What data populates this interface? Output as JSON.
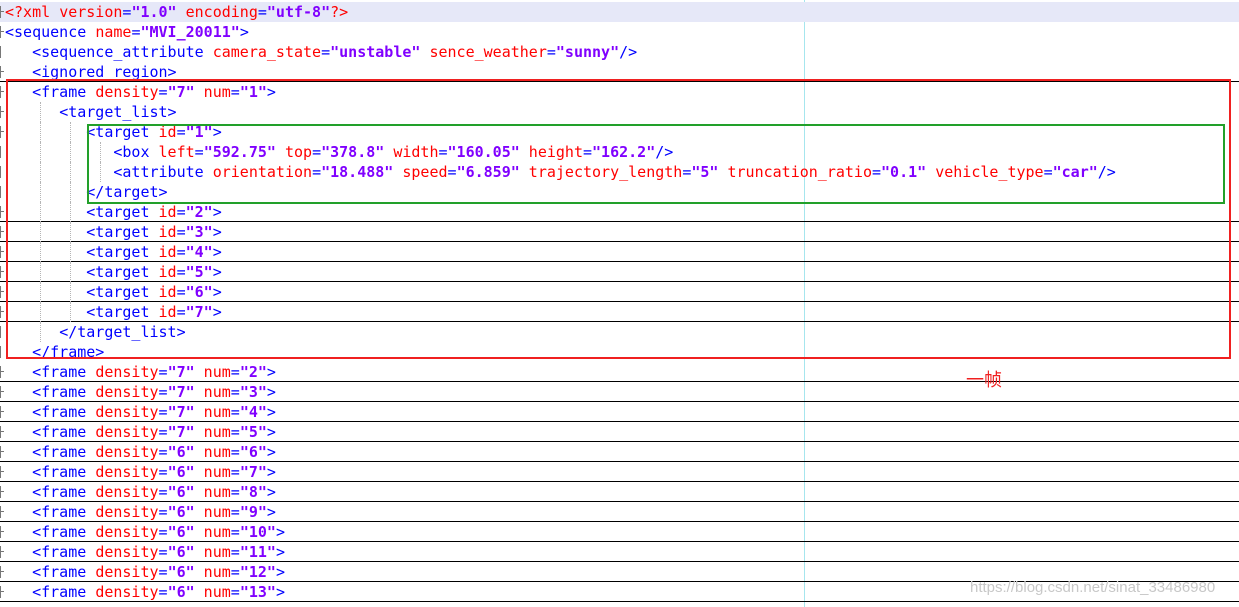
{
  "lines": [
    {
      "hl": true,
      "underline": false,
      "fold": "plus",
      "indent": 0,
      "tokens": [
        {
          "t": "<?xml ",
          "c": "pi"
        },
        {
          "t": "version",
          "c": "attr"
        },
        {
          "t": "=",
          "c": "eq"
        },
        {
          "t": "\"1.0\"",
          "c": "val"
        },
        {
          "t": " encoding",
          "c": "attr"
        },
        {
          "t": "=",
          "c": "eq"
        },
        {
          "t": "\"utf-8\"",
          "c": "val"
        },
        {
          "t": "?>",
          "c": "pi"
        }
      ]
    },
    {
      "hl": false,
      "underline": false,
      "fold": "plus",
      "indent": 0,
      "tokens": [
        {
          "t": "<sequence ",
          "c": "tag"
        },
        {
          "t": "name",
          "c": "attr"
        },
        {
          "t": "=",
          "c": "eq"
        },
        {
          "t": "\"MVI_20011\"",
          "c": "val"
        },
        {
          "t": ">",
          "c": "tag"
        }
      ]
    },
    {
      "hl": false,
      "underline": false,
      "fold": "line",
      "indent": 1,
      "tokens": [
        {
          "t": "<sequence_attribute ",
          "c": "tag"
        },
        {
          "t": "camera_state",
          "c": "attr"
        },
        {
          "t": "=",
          "c": "eq"
        },
        {
          "t": "\"unstable\"",
          "c": "val"
        },
        {
          "t": " sence_weather",
          "c": "attr"
        },
        {
          "t": "=",
          "c": "eq"
        },
        {
          "t": "\"sunny\"",
          "c": "val"
        },
        {
          "t": "/>",
          "c": "tag"
        }
      ]
    },
    {
      "hl": false,
      "underline": true,
      "fold": "plus",
      "indent": 1,
      "tokens": [
        {
          "t": "<ignored_region>",
          "c": "tag"
        }
      ]
    },
    {
      "hl": false,
      "underline": false,
      "fold": "plus",
      "indent": 1,
      "tokens": [
        {
          "t": "<frame ",
          "c": "tag"
        },
        {
          "t": "density",
          "c": "attr"
        },
        {
          "t": "=",
          "c": "eq"
        },
        {
          "t": "\"7\"",
          "c": "val"
        },
        {
          "t": " num",
          "c": "attr"
        },
        {
          "t": "=",
          "c": "eq"
        },
        {
          "t": "\"1\"",
          "c": "val"
        },
        {
          "t": ">",
          "c": "tag"
        }
      ]
    },
    {
      "hl": false,
      "underline": false,
      "fold": "plus",
      "indent": 2,
      "tokens": [
        {
          "t": "<target_list>",
          "c": "tag"
        }
      ]
    },
    {
      "hl": false,
      "underline": false,
      "fold": "plus",
      "indent": 3,
      "tokens": [
        {
          "t": "<target ",
          "c": "tag"
        },
        {
          "t": "id",
          "c": "attr"
        },
        {
          "t": "=",
          "c": "eq"
        },
        {
          "t": "\"1\"",
          "c": "val"
        },
        {
          "t": ">",
          "c": "tag"
        }
      ]
    },
    {
      "hl": false,
      "underline": false,
      "fold": "line",
      "indent": 4,
      "tokens": [
        {
          "t": "<box ",
          "c": "tag"
        },
        {
          "t": "left",
          "c": "attr"
        },
        {
          "t": "=",
          "c": "eq"
        },
        {
          "t": "\"592.75\"",
          "c": "val"
        },
        {
          "t": " top",
          "c": "attr"
        },
        {
          "t": "=",
          "c": "eq"
        },
        {
          "t": "\"378.8\"",
          "c": "val"
        },
        {
          "t": " width",
          "c": "attr"
        },
        {
          "t": "=",
          "c": "eq"
        },
        {
          "t": "\"160.05\"",
          "c": "val"
        },
        {
          "t": " height",
          "c": "attr"
        },
        {
          "t": "=",
          "c": "eq"
        },
        {
          "t": "\"162.2\"",
          "c": "val"
        },
        {
          "t": "/>",
          "c": "tag"
        }
      ]
    },
    {
      "hl": false,
      "underline": false,
      "fold": "line",
      "indent": 4,
      "tokens": [
        {
          "t": "<attribute ",
          "c": "tag"
        },
        {
          "t": "orientation",
          "c": "attr"
        },
        {
          "t": "=",
          "c": "eq"
        },
        {
          "t": "\"18.488\"",
          "c": "val"
        },
        {
          "t": " speed",
          "c": "attr"
        },
        {
          "t": "=",
          "c": "eq"
        },
        {
          "t": "\"6.859\"",
          "c": "val"
        },
        {
          "t": " trajectory_length",
          "c": "attr"
        },
        {
          "t": "=",
          "c": "eq"
        },
        {
          "t": "\"5\"",
          "c": "val"
        },
        {
          "t": " truncation_ratio",
          "c": "attr"
        },
        {
          "t": "=",
          "c": "eq"
        },
        {
          "t": "\"0.1\"",
          "c": "val"
        },
        {
          "t": " vehicle_type",
          "c": "attr"
        },
        {
          "t": "=",
          "c": "eq"
        },
        {
          "t": "\"car\"",
          "c": "val"
        },
        {
          "t": "/>",
          "c": "tag"
        }
      ]
    },
    {
      "hl": false,
      "underline": false,
      "fold": "line",
      "indent": 3,
      "tokens": [
        {
          "t": "</target>",
          "c": "tag"
        }
      ]
    },
    {
      "hl": false,
      "underline": true,
      "fold": "plus",
      "indent": 3,
      "tokens": [
        {
          "t": "<target ",
          "c": "tag"
        },
        {
          "t": "id",
          "c": "attr"
        },
        {
          "t": "=",
          "c": "eq"
        },
        {
          "t": "\"2\"",
          "c": "val"
        },
        {
          "t": ">",
          "c": "tag"
        }
      ]
    },
    {
      "hl": false,
      "underline": true,
      "fold": "plus",
      "indent": 3,
      "tokens": [
        {
          "t": "<target ",
          "c": "tag"
        },
        {
          "t": "id",
          "c": "attr"
        },
        {
          "t": "=",
          "c": "eq"
        },
        {
          "t": "\"3\"",
          "c": "val"
        },
        {
          "t": ">",
          "c": "tag"
        }
      ]
    },
    {
      "hl": false,
      "underline": true,
      "fold": "plus",
      "indent": 3,
      "tokens": [
        {
          "t": "<target ",
          "c": "tag"
        },
        {
          "t": "id",
          "c": "attr"
        },
        {
          "t": "=",
          "c": "eq"
        },
        {
          "t": "\"4\"",
          "c": "val"
        },
        {
          "t": ">",
          "c": "tag"
        }
      ]
    },
    {
      "hl": false,
      "underline": true,
      "fold": "plus",
      "indent": 3,
      "tokens": [
        {
          "t": "<target ",
          "c": "tag"
        },
        {
          "t": "id",
          "c": "attr"
        },
        {
          "t": "=",
          "c": "eq"
        },
        {
          "t": "\"5\"",
          "c": "val"
        },
        {
          "t": ">",
          "c": "tag"
        }
      ]
    },
    {
      "hl": false,
      "underline": true,
      "fold": "plus",
      "indent": 3,
      "tokens": [
        {
          "t": "<target ",
          "c": "tag"
        },
        {
          "t": "id",
          "c": "attr"
        },
        {
          "t": "=",
          "c": "eq"
        },
        {
          "t": "\"6\"",
          "c": "val"
        },
        {
          "t": ">",
          "c": "tag"
        }
      ]
    },
    {
      "hl": false,
      "underline": true,
      "fold": "plus",
      "indent": 3,
      "tokens": [
        {
          "t": "<target ",
          "c": "tag"
        },
        {
          "t": "id",
          "c": "attr"
        },
        {
          "t": "=",
          "c": "eq"
        },
        {
          "t": "\"7\"",
          "c": "val"
        },
        {
          "t": ">",
          "c": "tag"
        }
      ]
    },
    {
      "hl": false,
      "underline": false,
      "fold": "line",
      "indent": 2,
      "tokens": [
        {
          "t": "</target_list>",
          "c": "tag"
        }
      ]
    },
    {
      "hl": false,
      "underline": false,
      "fold": "line",
      "indent": 1,
      "tokens": [
        {
          "t": "</frame>",
          "c": "tag"
        }
      ]
    },
    {
      "hl": false,
      "underline": true,
      "fold": "plus",
      "indent": 1,
      "tokens": [
        {
          "t": "<frame ",
          "c": "tag"
        },
        {
          "t": "density",
          "c": "attr"
        },
        {
          "t": "=",
          "c": "eq"
        },
        {
          "t": "\"7\"",
          "c": "val"
        },
        {
          "t": " num",
          "c": "attr"
        },
        {
          "t": "=",
          "c": "eq"
        },
        {
          "t": "\"2\"",
          "c": "val"
        },
        {
          "t": ">",
          "c": "tag"
        }
      ]
    },
    {
      "hl": false,
      "underline": true,
      "fold": "plus",
      "indent": 1,
      "tokens": [
        {
          "t": "<frame ",
          "c": "tag"
        },
        {
          "t": "density",
          "c": "attr"
        },
        {
          "t": "=",
          "c": "eq"
        },
        {
          "t": "\"7\"",
          "c": "val"
        },
        {
          "t": " num",
          "c": "attr"
        },
        {
          "t": "=",
          "c": "eq"
        },
        {
          "t": "\"3\"",
          "c": "val"
        },
        {
          "t": ">",
          "c": "tag"
        }
      ]
    },
    {
      "hl": false,
      "underline": true,
      "fold": "plus",
      "indent": 1,
      "tokens": [
        {
          "t": "<frame ",
          "c": "tag"
        },
        {
          "t": "density",
          "c": "attr"
        },
        {
          "t": "=",
          "c": "eq"
        },
        {
          "t": "\"7\"",
          "c": "val"
        },
        {
          "t": " num",
          "c": "attr"
        },
        {
          "t": "=",
          "c": "eq"
        },
        {
          "t": "\"4\"",
          "c": "val"
        },
        {
          "t": ">",
          "c": "tag"
        }
      ]
    },
    {
      "hl": false,
      "underline": true,
      "fold": "plus",
      "indent": 1,
      "tokens": [
        {
          "t": "<frame ",
          "c": "tag"
        },
        {
          "t": "density",
          "c": "attr"
        },
        {
          "t": "=",
          "c": "eq"
        },
        {
          "t": "\"7\"",
          "c": "val"
        },
        {
          "t": " num",
          "c": "attr"
        },
        {
          "t": "=",
          "c": "eq"
        },
        {
          "t": "\"5\"",
          "c": "val"
        },
        {
          "t": ">",
          "c": "tag"
        }
      ]
    },
    {
      "hl": false,
      "underline": true,
      "fold": "plus",
      "indent": 1,
      "tokens": [
        {
          "t": "<frame ",
          "c": "tag"
        },
        {
          "t": "density",
          "c": "attr"
        },
        {
          "t": "=",
          "c": "eq"
        },
        {
          "t": "\"6\"",
          "c": "val"
        },
        {
          "t": " num",
          "c": "attr"
        },
        {
          "t": "=",
          "c": "eq"
        },
        {
          "t": "\"6\"",
          "c": "val"
        },
        {
          "t": ">",
          "c": "tag"
        }
      ]
    },
    {
      "hl": false,
      "underline": true,
      "fold": "plus",
      "indent": 1,
      "tokens": [
        {
          "t": "<frame ",
          "c": "tag"
        },
        {
          "t": "density",
          "c": "attr"
        },
        {
          "t": "=",
          "c": "eq"
        },
        {
          "t": "\"6\"",
          "c": "val"
        },
        {
          "t": " num",
          "c": "attr"
        },
        {
          "t": "=",
          "c": "eq"
        },
        {
          "t": "\"7\"",
          "c": "val"
        },
        {
          "t": ">",
          "c": "tag"
        }
      ]
    },
    {
      "hl": false,
      "underline": true,
      "fold": "plus",
      "indent": 1,
      "tokens": [
        {
          "t": "<frame ",
          "c": "tag"
        },
        {
          "t": "density",
          "c": "attr"
        },
        {
          "t": "=",
          "c": "eq"
        },
        {
          "t": "\"6\"",
          "c": "val"
        },
        {
          "t": " num",
          "c": "attr"
        },
        {
          "t": "=",
          "c": "eq"
        },
        {
          "t": "\"8\"",
          "c": "val"
        },
        {
          "t": ">",
          "c": "tag"
        }
      ]
    },
    {
      "hl": false,
      "underline": true,
      "fold": "plus",
      "indent": 1,
      "tokens": [
        {
          "t": "<frame ",
          "c": "tag"
        },
        {
          "t": "density",
          "c": "attr"
        },
        {
          "t": "=",
          "c": "eq"
        },
        {
          "t": "\"6\"",
          "c": "val"
        },
        {
          "t": " num",
          "c": "attr"
        },
        {
          "t": "=",
          "c": "eq"
        },
        {
          "t": "\"9\"",
          "c": "val"
        },
        {
          "t": ">",
          "c": "tag"
        }
      ]
    },
    {
      "hl": false,
      "underline": true,
      "fold": "plus",
      "indent": 1,
      "tokens": [
        {
          "t": "<frame ",
          "c": "tag"
        },
        {
          "t": "density",
          "c": "attr"
        },
        {
          "t": "=",
          "c": "eq"
        },
        {
          "t": "\"6\"",
          "c": "val"
        },
        {
          "t": " num",
          "c": "attr"
        },
        {
          "t": "=",
          "c": "eq"
        },
        {
          "t": "\"10\"",
          "c": "val"
        },
        {
          "t": ">",
          "c": "tag"
        }
      ]
    },
    {
      "hl": false,
      "underline": true,
      "fold": "plus",
      "indent": 1,
      "tokens": [
        {
          "t": "<frame ",
          "c": "tag"
        },
        {
          "t": "density",
          "c": "attr"
        },
        {
          "t": "=",
          "c": "eq"
        },
        {
          "t": "\"6\"",
          "c": "val"
        },
        {
          "t": " num",
          "c": "attr"
        },
        {
          "t": "=",
          "c": "eq"
        },
        {
          "t": "\"11\"",
          "c": "val"
        },
        {
          "t": ">",
          "c": "tag"
        }
      ]
    },
    {
      "hl": false,
      "underline": true,
      "fold": "plus",
      "indent": 1,
      "tokens": [
        {
          "t": "<frame ",
          "c": "tag"
        },
        {
          "t": "density",
          "c": "attr"
        },
        {
          "t": "=",
          "c": "eq"
        },
        {
          "t": "\"6\"",
          "c": "val"
        },
        {
          "t": " num",
          "c": "attr"
        },
        {
          "t": "=",
          "c": "eq"
        },
        {
          "t": "\"12\"",
          "c": "val"
        },
        {
          "t": ">",
          "c": "tag"
        }
      ]
    },
    {
      "hl": false,
      "underline": true,
      "fold": "plus",
      "indent": 1,
      "tokens": [
        {
          "t": "<frame ",
          "c": "tag"
        },
        {
          "t": "density",
          "c": "attr"
        },
        {
          "t": "=",
          "c": "eq"
        },
        {
          "t": "\"6\"",
          "c": "val"
        },
        {
          "t": " num",
          "c": "attr"
        },
        {
          "t": "=",
          "c": "eq"
        },
        {
          "t": "\"13\"",
          "c": "val"
        },
        {
          "t": ">",
          "c": "tag"
        }
      ]
    }
  ],
  "annotation": {
    "label": "一帧"
  },
  "watermark": {
    "text": "https://blog.csdn.net/sinat_33486980"
  },
  "colors": {
    "tag": "#0000ff",
    "attribute": "#ff0000",
    "value": "#8000ff",
    "frame_box": "#f02020",
    "target_box": "#22a02a"
  }
}
